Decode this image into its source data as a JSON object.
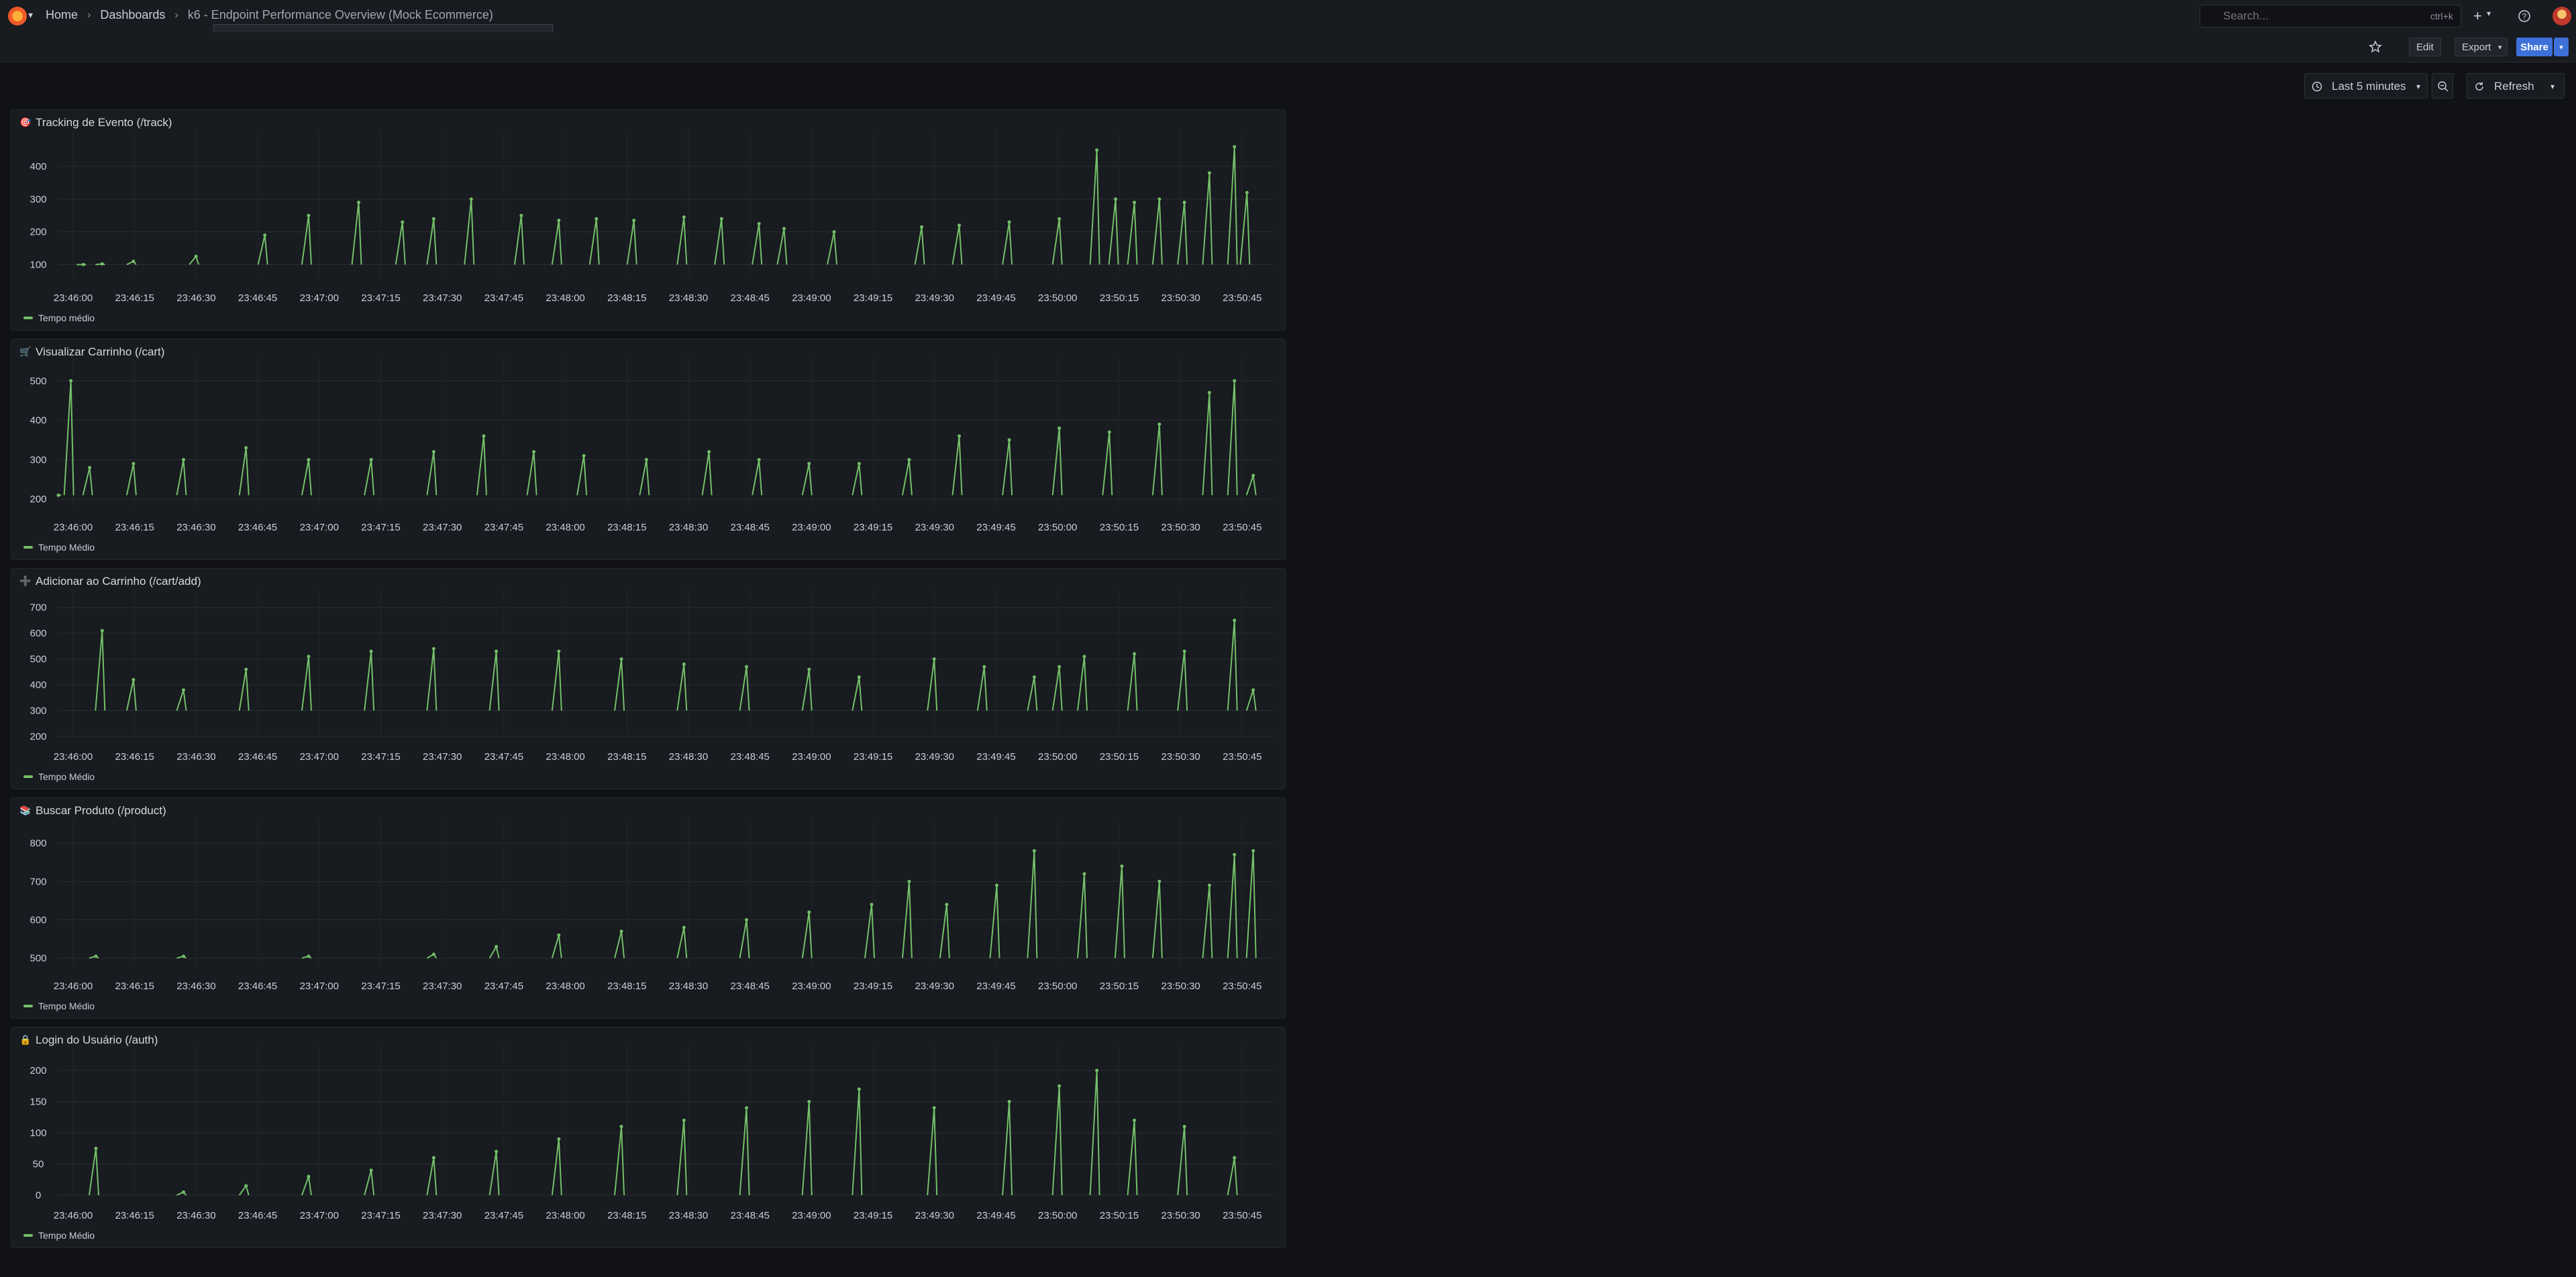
{
  "breadcrumb": [
    "Home",
    "Dashboards",
    "k6 - Endpoint Performance Overview (Mock Ecommerce)"
  ],
  "tooltip": "k6 - Endpoint Performance Overview (Mock Ecommerce)",
  "search": {
    "placeholder": "Search...",
    "shortcut": "ctrl+k"
  },
  "toolbar": {
    "edit": "Edit",
    "export": "Export",
    "share": "Share"
  },
  "time_picker": {
    "range": "Last 5 minutes",
    "refresh": "Refresh"
  },
  "colors": {
    "series": "#73bf69",
    "background": "#111217",
    "panel": "#181b1f",
    "primary": "#3d71d9"
  },
  "panels": [
    {
      "title": "Tracking de Evento (/track)",
      "icon": "target-icon",
      "legend": "Tempo médio"
    },
    {
      "title": "Visualizar Carrinho (/cart)",
      "icon": "cart-icon",
      "legend": "Tempo Médio"
    },
    {
      "title": "Adicionar ao Carrinho (/cart/add)",
      "icon": "plus-icon",
      "legend": "Tempo Médio"
    },
    {
      "title": "Buscar Produto (/product)",
      "icon": "books-icon",
      "legend": "Tempo Médio"
    },
    {
      "title": "Login do Usuário (/auth)",
      "icon": "lock-icon",
      "legend": "Tempo Médio"
    }
  ],
  "chart_data": [
    {
      "type": "line",
      "title": "Tracking de Evento (/track)",
      "series": [
        {
          "name": "Tempo médio"
        }
      ],
      "y_ticks": [
        100,
        200,
        300,
        400
      ],
      "ylim": [
        60,
        470
      ],
      "x_ticks": [
        "23:46:00",
        "23:46:15",
        "23:46:30",
        "23:46:45",
        "23:47:00",
        "23:47:15",
        "23:47:30",
        "23:47:45",
        "23:48:00",
        "23:48:15",
        "23:48:30",
        "23:48:45",
        "23:49:00",
        "23:49:15",
        "23:49:30",
        "23:49:45",
        "23:50:00",
        "23:50:15",
        "23:50:30",
        "23:50:45"
      ],
      "base": 100,
      "peaks": [
        [
          20,
          100
        ],
        [
          35,
          102
        ],
        [
          60,
          110
        ],
        [
          110,
          125
        ],
        [
          165,
          190
        ],
        [
          200,
          250
        ],
        [
          240,
          290
        ],
        [
          275,
          230
        ],
        [
          300,
          240
        ],
        [
          330,
          300
        ],
        [
          370,
          250
        ],
        [
          400,
          235
        ],
        [
          430,
          240
        ],
        [
          460,
          235
        ],
        [
          500,
          245
        ],
        [
          530,
          240
        ],
        [
          560,
          225
        ],
        [
          580,
          210
        ],
        [
          620,
          200
        ],
        [
          690,
          215
        ],
        [
          720,
          220
        ],
        [
          760,
          230
        ],
        [
          800,
          240
        ],
        [
          830,
          450
        ],
        [
          845,
          300
        ],
        [
          860,
          290
        ],
        [
          880,
          300
        ],
        [
          900,
          290
        ],
        [
          920,
          380
        ],
        [
          940,
          460
        ],
        [
          950,
          320
        ]
      ]
    },
    {
      "type": "line",
      "title": "Visualizar Carrinho (/cart)",
      "series": [
        {
          "name": "Tempo Médio"
        }
      ],
      "y_ticks": [
        200,
        300,
        400,
        500
      ],
      "ylim": [
        180,
        520
      ],
      "x_ticks": [
        "23:46:00",
        "23:46:15",
        "23:46:30",
        "23:46:45",
        "23:47:00",
        "23:47:15",
        "23:47:30",
        "23:47:45",
        "23:48:00",
        "23:48:15",
        "23:48:30",
        "23:48:45",
        "23:49:00",
        "23:49:15",
        "23:49:30",
        "23:49:45",
        "23:50:00",
        "23:50:15",
        "23:50:30",
        "23:50:45"
      ],
      "base": 210,
      "peaks": [
        [
          0,
          210
        ],
        [
          10,
          500
        ],
        [
          25,
          280
        ],
        [
          60,
          290
        ],
        [
          100,
          300
        ],
        [
          150,
          330
        ],
        [
          200,
          300
        ],
        [
          250,
          300
        ],
        [
          300,
          320
        ],
        [
          340,
          360
        ],
        [
          380,
          320
        ],
        [
          420,
          310
        ],
        [
          470,
          300
        ],
        [
          520,
          320
        ],
        [
          560,
          300
        ],
        [
          600,
          290
        ],
        [
          640,
          290
        ],
        [
          680,
          300
        ],
        [
          720,
          360
        ],
        [
          760,
          350
        ],
        [
          800,
          380
        ],
        [
          840,
          370
        ],
        [
          880,
          390
        ],
        [
          920,
          470
        ],
        [
          940,
          500
        ],
        [
          955,
          260
        ]
      ]
    },
    {
      "type": "line",
      "title": "Adicionar ao Carrinho (/cart/add)",
      "series": [
        {
          "name": "Tempo Médio"
        }
      ],
      "y_ticks": [
        200,
        300,
        400,
        500,
        600,
        700
      ],
      "ylim": [
        200,
        720
      ],
      "x_ticks": [
        "23:46:00",
        "23:46:15",
        "23:46:30",
        "23:46:45",
        "23:47:00",
        "23:47:15",
        "23:47:30",
        "23:47:45",
        "23:48:00",
        "23:48:15",
        "23:48:30",
        "23:48:45",
        "23:49:00",
        "23:49:15",
        "23:49:30",
        "23:49:45",
        "23:50:00",
        "23:50:15",
        "23:50:30",
        "23:50:45"
      ],
      "base": 300,
      "peaks": [
        [
          35,
          610
        ],
        [
          60,
          420
        ],
        [
          100,
          380
        ],
        [
          150,
          460
        ],
        [
          200,
          510
        ],
        [
          250,
          530
        ],
        [
          300,
          540
        ],
        [
          350,
          530
        ],
        [
          400,
          530
        ],
        [
          450,
          500
        ],
        [
          500,
          480
        ],
        [
          550,
          470
        ],
        [
          600,
          460
        ],
        [
          640,
          430
        ],
        [
          700,
          500
        ],
        [
          740,
          470
        ],
        [
          780,
          430
        ],
        [
          800,
          470
        ],
        [
          820,
          510
        ],
        [
          860,
          520
        ],
        [
          900,
          530
        ],
        [
          940,
          650
        ],
        [
          955,
          380
        ]
      ]
    },
    {
      "type": "line",
      "title": "Buscar Produto (/product)",
      "series": [
        {
          "name": "Tempo Médio"
        }
      ],
      "y_ticks": [
        500,
        600,
        700,
        800
      ],
      "ylim": [
        480,
        830
      ],
      "x_ticks": [
        "23:46:00",
        "23:46:15",
        "23:46:30",
        "23:46:45",
        "23:47:00",
        "23:47:15",
        "23:47:30",
        "23:47:45",
        "23:48:00",
        "23:48:15",
        "23:48:30",
        "23:48:45",
        "23:49:00",
        "23:49:15",
        "23:49:30",
        "23:49:45",
        "23:50:00",
        "23:50:15",
        "23:50:30",
        "23:50:45"
      ],
      "base": 500,
      "peaks": [
        [
          30,
          505
        ],
        [
          100,
          505
        ],
        [
          200,
          505
        ],
        [
          300,
          510
        ],
        [
          350,
          530
        ],
        [
          400,
          560
        ],
        [
          450,
          570
        ],
        [
          500,
          580
        ],
        [
          550,
          600
        ],
        [
          600,
          620
        ],
        [
          650,
          640
        ],
        [
          680,
          700
        ],
        [
          710,
          640
        ],
        [
          750,
          690
        ],
        [
          780,
          780
        ],
        [
          820,
          720
        ],
        [
          850,
          740
        ],
        [
          880,
          700
        ],
        [
          920,
          690
        ],
        [
          940,
          770
        ],
        [
          955,
          780
        ]
      ]
    },
    {
      "type": "line",
      "title": "Login do Usuário (/auth)",
      "series": [
        {
          "name": "Tempo Médio"
        }
      ],
      "y_ticks": [
        0,
        50,
        100,
        150,
        200
      ],
      "ylim": [
        0,
        215
      ],
      "x_ticks": [
        "23:46:00",
        "23:46:15",
        "23:46:30",
        "23:46:45",
        "23:47:00",
        "23:47:15",
        "23:47:30",
        "23:47:45",
        "23:48:00",
        "23:48:15",
        "23:48:30",
        "23:48:45",
        "23:49:00",
        "23:49:15",
        "23:49:30",
        "23:49:45",
        "23:50:00",
        "23:50:15",
        "23:50:30",
        "23:50:45"
      ],
      "base": 0,
      "peaks": [
        [
          30,
          75
        ],
        [
          100,
          5
        ],
        [
          150,
          15
        ],
        [
          200,
          30
        ],
        [
          250,
          40
        ],
        [
          300,
          60
        ],
        [
          350,
          70
        ],
        [
          400,
          90
        ],
        [
          450,
          110
        ],
        [
          500,
          120
        ],
        [
          550,
          140
        ],
        [
          600,
          150
        ],
        [
          640,
          170
        ],
        [
          700,
          140
        ],
        [
          760,
          150
        ],
        [
          800,
          175
        ],
        [
          830,
          200
        ],
        [
          860,
          120
        ],
        [
          900,
          110
        ],
        [
          940,
          60
        ]
      ]
    }
  ]
}
